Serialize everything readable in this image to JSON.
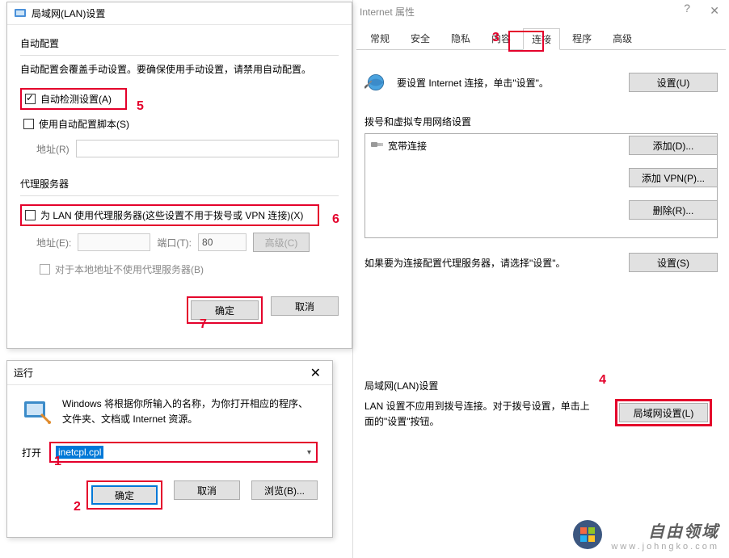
{
  "ie": {
    "title": "Internet 属性",
    "tabs": [
      "常规",
      "安全",
      "隐私",
      "内容",
      "连接",
      "程序",
      "高级"
    ],
    "active_tab": "连接",
    "setup_text": "要设置 Internet 连接，单击\"设置\"。",
    "setup_btn": "设置(U)",
    "dial_group": "拨号和虚拟专用网络设置",
    "dial_item": "宽带连接",
    "add_btn": "添加(D)...",
    "add_vpn_btn": "添加 VPN(P)...",
    "remove_btn": "删除(R)...",
    "settings_btn": "设置(S)",
    "proxy_note": "如果要为连接配置代理服务器，请选择\"设置\"。",
    "lan_group": "局域网(LAN)设置",
    "lan_note": "LAN 设置不应用到拨号连接。对于拨号设置，单击上面的\"设置\"按钮。",
    "lan_btn": "局域网设置(L)"
  },
  "lan": {
    "title": "局域网(LAN)设置",
    "auto_group": "自动配置",
    "auto_desc": "自动配置会覆盖手动设置。要确保使用手动设置，请禁用自动配置。",
    "auto_detect": "自动检测设置(A)",
    "use_script": "使用自动配置脚本(S)",
    "addr_label": "地址(R)",
    "proxy_group": "代理服务器",
    "proxy_check": "为 LAN 使用代理服务器(这些设置不用于拨号或 VPN 连接)(X)",
    "addr2_label": "地址(E):",
    "port_label": "端口(T):",
    "port_value": "80",
    "adv_btn": "高级(C)",
    "bypass_local": "对于本地地址不使用代理服务器(B)",
    "ok": "确定",
    "cancel": "取消"
  },
  "run": {
    "title": "运行",
    "desc": "Windows 将根据你所输入的名称，为你打开相应的程序、文件夹、文档或 Internet 资源。",
    "open_label": "打开",
    "value": "inetcpl.cpl",
    "ok": "确定",
    "cancel": "取消",
    "browse": "浏览(B)..."
  },
  "annotations": {
    "n1": "1",
    "n2": "2",
    "n3": "3",
    "n4": "4",
    "n5": "5",
    "n6": "6",
    "n7": "7"
  },
  "watermark": {
    "title": "自由领域",
    "sub": "www.johngko.com"
  }
}
